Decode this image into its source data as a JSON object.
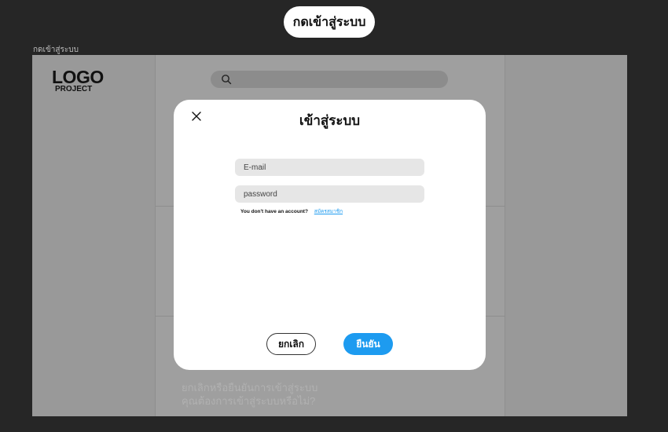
{
  "top_button": {
    "label": "กดเข้าสู่ระบบ"
  },
  "frame": {
    "label": "กดเข้าสู่ระบบ"
  },
  "logo": {
    "main": "LOGO",
    "sub": "PROJECT"
  },
  "background_text": {
    "line1": "ยกเลิกหรือยืนยันการเข้าสู่ระบบ",
    "line2": "คุณต้องการเข้าสู่ระบบหรือไม่?"
  },
  "modal": {
    "title": "เข้าสู่ระบบ",
    "email_placeholder": "E-mail",
    "password_placeholder": "password",
    "account_question": "You don't have an account?",
    "register_link": "สมัครสมาชิก",
    "cancel_label": "ยกเลิก",
    "confirm_label": "ยืนยัน"
  },
  "colors": {
    "accent": "#1d9bf0",
    "page_background": "#262626",
    "overlay": "#9b9b9b",
    "modal_background": "#ffffff",
    "input_background": "#e6e6e6"
  },
  "icons": {
    "search": "search-icon",
    "close": "close-icon"
  }
}
